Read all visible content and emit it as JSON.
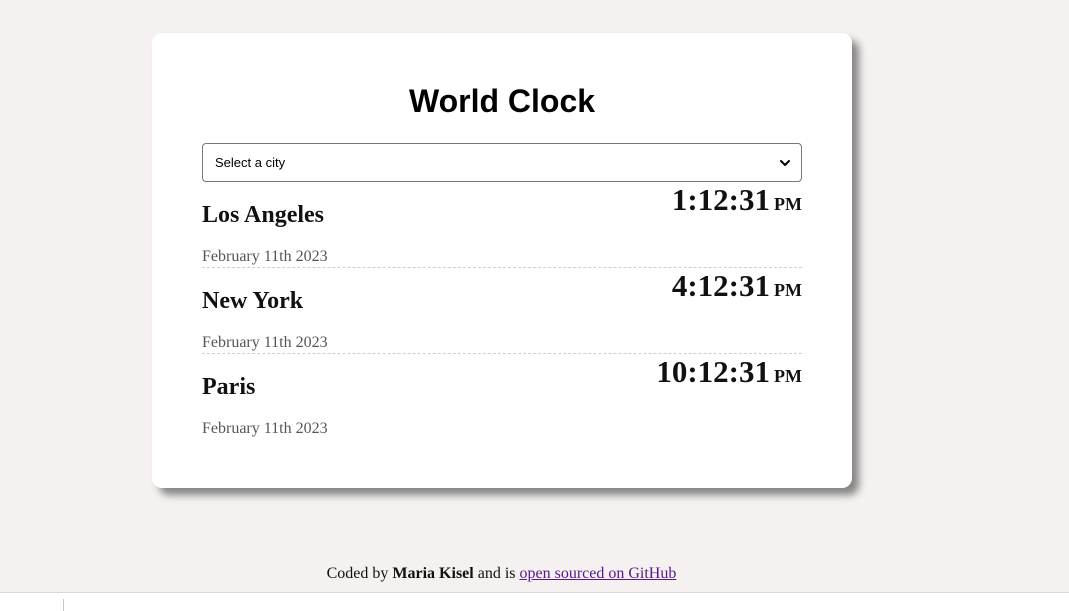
{
  "title": "World Clock",
  "select": {
    "selected": "Select a city",
    "icon": "chevron-down-icon"
  },
  "cities": [
    {
      "name": "Los Angeles",
      "date": "February 11th 2023",
      "time": "1:12:31",
      "ampm": "PM"
    },
    {
      "name": "New York",
      "date": "February 11th 2023",
      "time": "4:12:31",
      "ampm": "PM"
    },
    {
      "name": "Paris",
      "date": "February 11th 2023",
      "time": "10:12:31",
      "ampm": "PM"
    }
  ],
  "footer": {
    "prefix": "Coded by ",
    "author": "Maria Kisel",
    "middle": " and is ",
    "link_text": "open sourced on GitHub"
  },
  "colors": {
    "background": "#f4f1f0",
    "card": "#ffffff",
    "link": "#551a8b"
  }
}
